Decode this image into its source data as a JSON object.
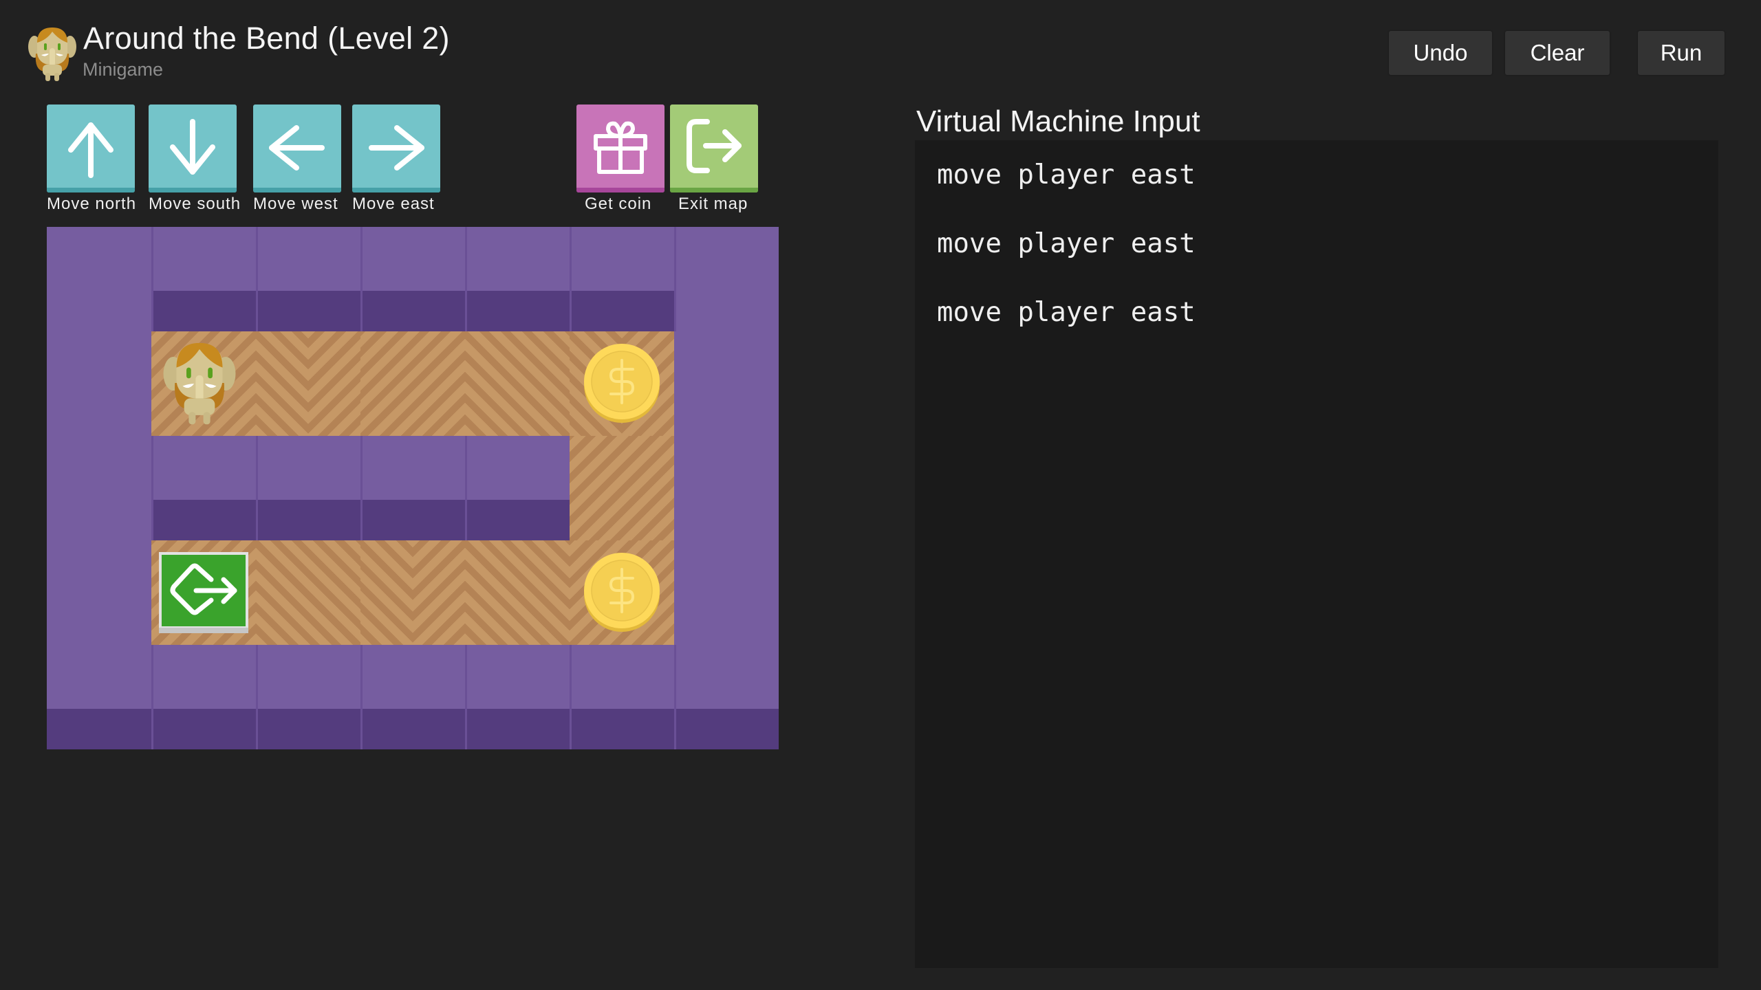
{
  "header": {
    "title": "Around the Bend (Level 2)",
    "subtitle": "Minigame",
    "logo_icon": "elephant-avatar-icon",
    "buttons": {
      "undo": "Undo",
      "clear": "Clear",
      "run": "Run"
    }
  },
  "commands": [
    {
      "id": "move-north",
      "label": "Move north",
      "icon": "arrow-up-icon",
      "color": "#74c4c9"
    },
    {
      "id": "move-south",
      "label": "Move south",
      "icon": "arrow-down-icon",
      "color": "#74c4c9"
    },
    {
      "id": "move-west",
      "label": "Move west",
      "icon": "arrow-left-icon",
      "color": "#74c4c9"
    },
    {
      "id": "move-east",
      "label": "Move east",
      "icon": "arrow-right-icon",
      "color": "#74c4c9"
    },
    {
      "id": "get-coin",
      "label": "Get coin",
      "icon": "gift-icon",
      "color": "#c874b8"
    },
    {
      "id": "exit-map",
      "label": "Exit map",
      "icon": "exit-icon",
      "color": "#a3cb77"
    }
  ],
  "map": {
    "columns": 7,
    "rows": 5,
    "legend": {
      "W": "wall",
      "F": "floor",
      "P": "player",
      "C": "coin",
      "E": "exit"
    },
    "grid": [
      "WWWWWWW",
      "WPFFFCW",
      "WWWWWFW",
      "WEFFFCW",
      "WWWWWWW"
    ],
    "colors": {
      "wall_top": "#765da0",
      "wall_front": "#543c7e",
      "floor": "#c69866",
      "floor_stripe": "#b48355",
      "coin": "#f5cf52",
      "exit": "#3aa32c"
    }
  },
  "vm": {
    "title": "Virtual Machine Input",
    "lines": [
      "move player east",
      "move player east",
      "move player east"
    ]
  }
}
